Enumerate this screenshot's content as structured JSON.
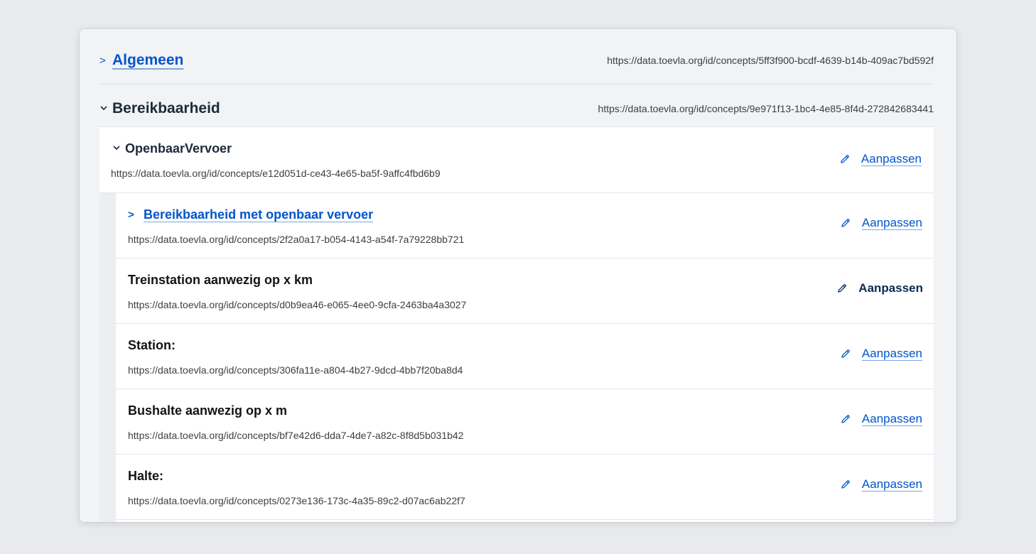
{
  "sections": [
    {
      "title": "Algemeen",
      "url": "https://data.toevla.org/id/concepts/5ff3f900-bcdf-4639-b14b-409ac7bd592f",
      "expanded": false
    },
    {
      "title": "Bereikbaarheid",
      "url": "https://data.toevla.org/id/concepts/9e971f13-1bc4-4e85-8f4d-272842683441",
      "expanded": true
    }
  ],
  "subsection": {
    "title": "OpenbaarVervoer",
    "url": "https://data.toevla.org/id/concepts/e12d051d-ce43-4e65-ba5f-9affc4fbd6b9",
    "edit_label": "Aanpassen"
  },
  "items": [
    {
      "title": "Bereikbaarheid met openbaar vervoer",
      "url": "https://data.toevla.org/id/concepts/2f2a0a17-b054-4143-a54f-7a79228bb721",
      "edit_label": "Aanpassen",
      "collapsible": true
    },
    {
      "title": "Treinstation aanwezig op x km",
      "url": "https://data.toevla.org/id/concepts/d0b9ea46-e065-4ee0-9cfa-2463ba4a3027",
      "edit_label": "Aanpassen",
      "hovered": true
    },
    {
      "title": "Station:",
      "url": "https://data.toevla.org/id/concepts/306fa11e-a804-4b27-9dcd-4bb7f20ba8d4",
      "edit_label": "Aanpassen"
    },
    {
      "title": "Bushalte aanwezig op x m",
      "url": "https://data.toevla.org/id/concepts/bf7e42d6-dda7-4de7-a82c-8f8d5b031b42",
      "edit_label": "Aanpassen"
    },
    {
      "title": "Halte:",
      "url": "https://data.toevla.org/id/concepts/0273e136-173c-4a35-89c2-d07ac6ab22f7",
      "edit_label": "Aanpassen"
    }
  ],
  "colors": {
    "link": "#0055cc",
    "heading": "#1d2a3a",
    "background": "#e8eaee"
  },
  "icons": {
    "collapsed": "chevron-right-icon",
    "expanded": "chevron-down-icon",
    "edit": "pencil-icon"
  }
}
